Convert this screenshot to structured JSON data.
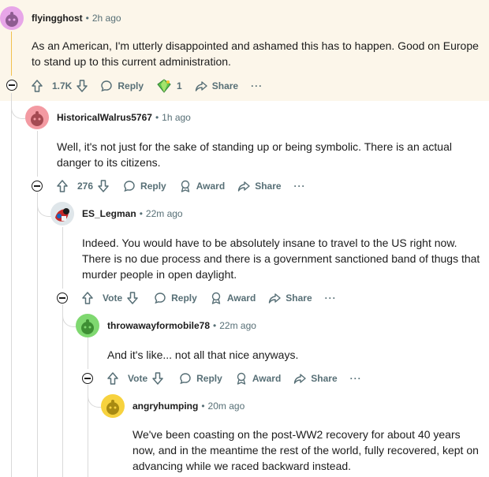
{
  "comments": [
    {
      "user": "flyingghost",
      "time": "2h ago",
      "text": "As an American, I'm utterly disappointed and ashamed this has to happen. Good on Europe to stand up to this current administration.",
      "votes": "1.7K",
      "reply": "Reply",
      "award_count": "1",
      "share": "Share",
      "more": "···",
      "avatar_color": "#e7a6e8"
    },
    {
      "user": "HistoricalWalrus5767",
      "time": "1h ago",
      "text": "Well, it's not just for the sake of standing up or being symbolic. There is an actual danger to its citizens.",
      "votes": "276",
      "reply": "Reply",
      "award": "Award",
      "share": "Share",
      "more": "···",
      "avatar_color": "#f39aa2"
    },
    {
      "user": "ES_Legman",
      "time": "22m ago",
      "text": "Indeed. You would have to be absolutely insane to travel to the US right now. There is no due process and there is a government sanctioned band of thugs that murder people in open daylight.",
      "votes": "Vote",
      "reply": "Reply",
      "award": "Award",
      "share": "Share",
      "more": "···"
    },
    {
      "user": "throwawayformobile78",
      "time": "22m ago",
      "text": "And it's like... not all that nice anyways.",
      "votes": "Vote",
      "reply": "Reply",
      "award": "Award",
      "share": "Share",
      "more": "···",
      "avatar_color": "#7fd870"
    },
    {
      "user": "angryhumping",
      "time": "20m ago",
      "text": "We've been coasting on the post-WW2 recovery for about 40 years now, and in the meantime the rest of the world, fully recovered, kept on advancing while we raced backward instead.",
      "avatar_color": "#f7d23e"
    }
  ]
}
